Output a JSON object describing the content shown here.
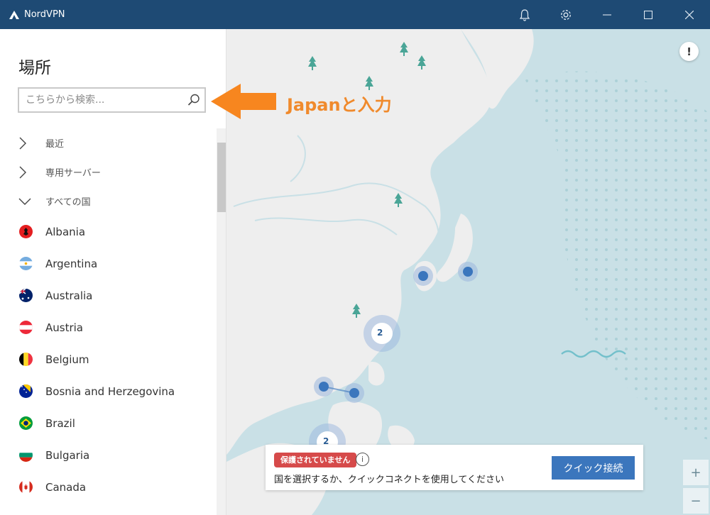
{
  "window": {
    "title": "NordVPN",
    "controls": [
      "bell-icon",
      "gear-icon",
      "minimize-icon",
      "maximize-icon",
      "close-icon"
    ]
  },
  "sidebar": {
    "heading": "場所",
    "search": {
      "placeholder": "こちらから検索...",
      "value": ""
    },
    "categories": [
      {
        "label": "最近",
        "expanded": false
      },
      {
        "label": "専用サーバー",
        "expanded": false
      },
      {
        "label": "すべての国",
        "expanded": true
      }
    ],
    "countries": [
      {
        "name": "Albania",
        "flag": "albania-flag-icon"
      },
      {
        "name": "Argentina",
        "flag": "argentina-flag-icon"
      },
      {
        "name": "Australia",
        "flag": "australia-flag-icon"
      },
      {
        "name": "Austria",
        "flag": "austria-flag-icon"
      },
      {
        "name": "Belgium",
        "flag": "belgium-flag-icon"
      },
      {
        "name": "Bosnia and Herzegovina",
        "flag": "bosnia-flag-icon"
      },
      {
        "name": "Brazil",
        "flag": "brazil-flag-icon"
      },
      {
        "name": "Bulgaria",
        "flag": "bulgaria-flag-icon"
      },
      {
        "name": "Canada",
        "flag": "canada-flag-icon"
      }
    ]
  },
  "annotation": {
    "text": "Japanと入力",
    "color": "#f08a2c"
  },
  "map": {
    "clusters": [
      {
        "count": "2"
      },
      {
        "count": "2"
      }
    ]
  },
  "status": {
    "badge": "保護されていません",
    "message": "国を選択するか、クイックコネクトを使用してください",
    "quick_connect": "クイック接続"
  },
  "zoom": {
    "in": "+",
    "out": "−"
  },
  "colors": {
    "titlebar": "#1e4a74",
    "map_water": "#c9e0e6",
    "map_land": "#eeeeee",
    "accent_blue": "#3b76bd",
    "badge_red": "#d64a4a",
    "annotation_orange": "#f08a2c"
  }
}
